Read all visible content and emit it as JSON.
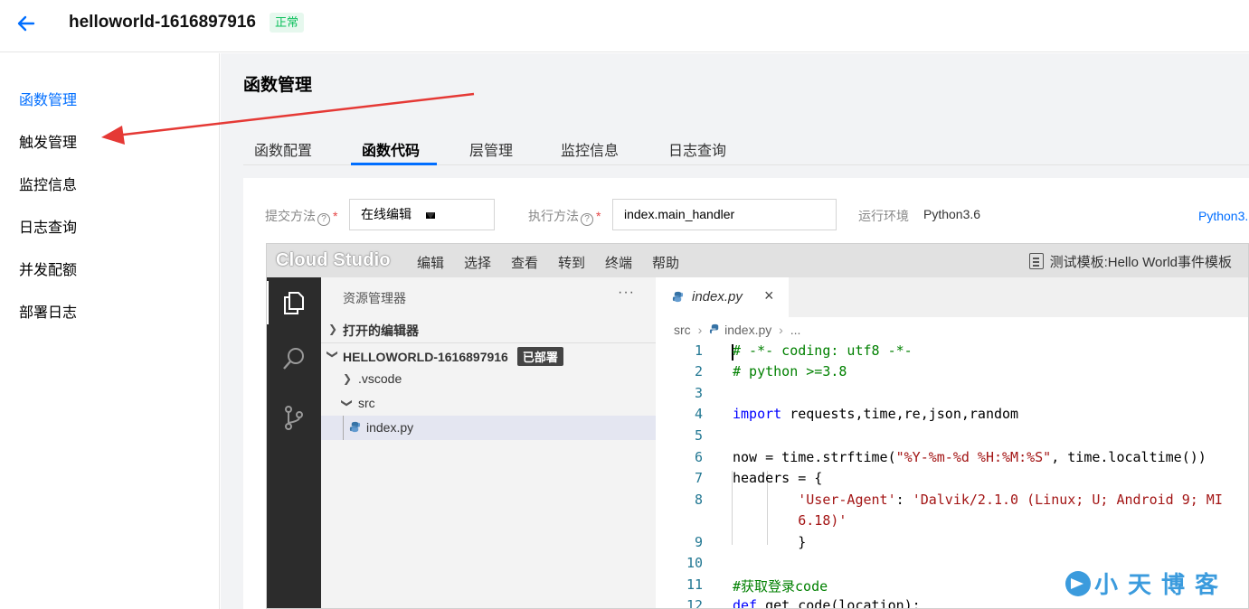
{
  "header": {
    "function_name": "helloworld-1616897916",
    "status": "正常"
  },
  "sidebar": {
    "items": [
      {
        "label": "函数管理",
        "active": true
      },
      {
        "label": "触发管理",
        "active": false
      },
      {
        "label": "监控信息",
        "active": false
      },
      {
        "label": "日志查询",
        "active": false
      },
      {
        "label": "并发配额",
        "active": false
      },
      {
        "label": "部署日志",
        "active": false
      }
    ]
  },
  "main": {
    "page_title": "函数管理",
    "tabs": [
      {
        "label": "函数配置",
        "active": false
      },
      {
        "label": "函数代码",
        "active": true
      },
      {
        "label": "层管理",
        "active": false
      },
      {
        "label": "监控信息",
        "active": false
      },
      {
        "label": "日志查询",
        "active": false
      }
    ],
    "form": {
      "submit_label": "提交方法",
      "submit_value": "在线编辑",
      "exec_label": "执行方法",
      "exec_value": "index.main_handler",
      "runtime_label": "运行环境",
      "runtime_value": "Python3.6",
      "doc_link": "Python3."
    }
  },
  "studio": {
    "logo": "Cloud Studio",
    "menu": [
      "编辑",
      "选择",
      "查看",
      "转到",
      "终端",
      "帮助"
    ],
    "template_label": "测试模板:Hello World事件模板",
    "explorer": {
      "title": "资源管理器",
      "more": "···",
      "open_editors": "打开的编辑器",
      "project": "HELLOWORLD-1616897916",
      "project_badge": "已部署",
      "items": [
        ".vscode",
        "src",
        "index.py"
      ]
    },
    "editor": {
      "tab_name": "index.py",
      "close": "×",
      "breadcrumb": [
        "src",
        "index.py",
        "..."
      ],
      "line_numbers": [
        "1",
        "2",
        "3",
        "4",
        "5",
        "6",
        "7",
        "8",
        "",
        "9",
        "10",
        "11",
        "12"
      ],
      "lines": [
        "# -*- coding: utf8 -*-",
        "# python >=3.8",
        "",
        "import requests,time,re,json,random",
        "",
        "now = time.strftime(\"%Y-%m-%d %H:%M:%S\", time.localtime())",
        "headers = {",
        "        'User-Agent': 'Dalvik/2.1.0 (Linux; U; Android 9; MI",
        "        6.18)'",
        "        }",
        "",
        "#获取登录code",
        "def get_code(location):"
      ]
    }
  },
  "watermark": "小天博客",
  "colors": {
    "accent": "#006eff",
    "status_green": "#0abf5b",
    "arrow": "#e53935"
  }
}
